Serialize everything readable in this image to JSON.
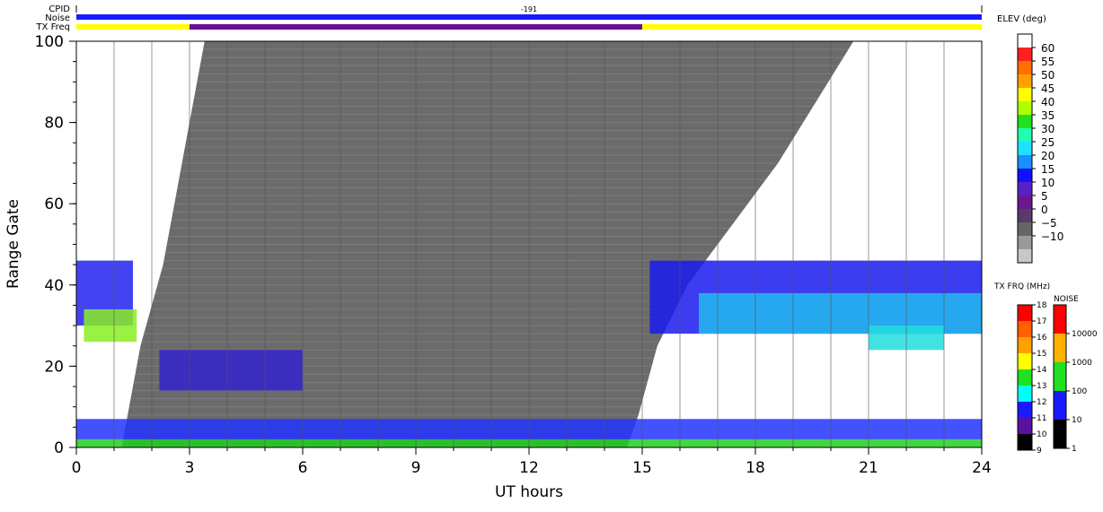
{
  "header": {
    "cpid_label": "CPID",
    "noise_label": "Noise",
    "txfreq_label": "TX Freq",
    "cpid_value": "-191"
  },
  "colors": {
    "ground_scatter": "#6b6b6b",
    "noise_band": "#1a1aff",
    "txfreq_low": "#ffff00",
    "txfreq_high": "#6a0f8e"
  },
  "chart_data": {
    "type": "heatmap",
    "xlabel": "UT hours",
    "ylabel": "Range Gate",
    "xlim": [
      0,
      24
    ],
    "ylim": [
      0,
      100
    ],
    "xticks": [
      0,
      3,
      6,
      9,
      12,
      15,
      18,
      21,
      24
    ],
    "yticks": [
      0,
      20,
      40,
      60,
      80,
      100
    ],
    "vertical_grid_hours": [
      1,
      2,
      3,
      4,
      5,
      6,
      7,
      8,
      9,
      10,
      11,
      12,
      13,
      14,
      15,
      16,
      17,
      18,
      19,
      20,
      21,
      22,
      23
    ],
    "txfreq_segments": [
      {
        "start": 0,
        "end": 3,
        "color": "#ffff00"
      },
      {
        "start": 3,
        "end": 15,
        "color": "#6a0f8e"
      },
      {
        "start": 15,
        "end": 24,
        "color": "#ffff00"
      }
    ],
    "ground_region_edge": [
      [
        1.2,
        0
      ],
      [
        1.3,
        5
      ],
      [
        1.5,
        15
      ],
      [
        1.7,
        25
      ],
      [
        2.0,
        35
      ],
      [
        2.3,
        45
      ],
      [
        2.6,
        60
      ],
      [
        2.9,
        75
      ],
      [
        3.2,
        90
      ],
      [
        3.4,
        100
      ]
    ],
    "ground_region_right_edge": [
      [
        14.6,
        0
      ],
      [
        14.9,
        8
      ],
      [
        15.4,
        25
      ],
      [
        16.2,
        40
      ],
      [
        17.4,
        55
      ],
      [
        18.6,
        70
      ],
      [
        19.6,
        85
      ],
      [
        20.6,
        100
      ]
    ],
    "echo_regions": [
      {
        "x0": 0,
        "x1": 1.5,
        "y0": 30,
        "y1": 46,
        "color": "#2222ee"
      },
      {
        "x0": 0.2,
        "x1": 1.6,
        "y0": 26,
        "y1": 34,
        "color": "#88ee22"
      },
      {
        "x0": 2.2,
        "x1": 6.0,
        "y0": 14,
        "y1": 24,
        "color": "#3322cc"
      },
      {
        "x0": 15.2,
        "x1": 24,
        "y0": 28,
        "y1": 46,
        "color": "#1a1aee"
      },
      {
        "x0": 16.5,
        "x1": 24,
        "y0": 28,
        "y1": 38,
        "color": "#22bbee"
      },
      {
        "x0": 21,
        "x1": 23,
        "y0": 24,
        "y1": 30,
        "color": "#22dddd"
      },
      {
        "x0": 0,
        "x1": 24,
        "y0": 0,
        "y1": 2,
        "color": "#22cc22"
      },
      {
        "x0": 0,
        "x1": 24,
        "y0": 2,
        "y1": 7,
        "color": "#2233ff"
      }
    ],
    "elev_legend": {
      "title": "ELEV (deg)",
      "ticks": [
        "60",
        "55",
        "50",
        "45",
        "40",
        "35",
        "30",
        "25",
        "20",
        "15",
        "10",
        "5",
        "0",
        "−5",
        "−10"
      ],
      "colors": [
        "#ffffff",
        "#ff2020",
        "#ff7000",
        "#ffa000",
        "#ffff00",
        "#b0ff00",
        "#20e020",
        "#20ffb0",
        "#20e0ff",
        "#1a90ff",
        "#1010ff",
        "#5a20c8",
        "#6a1890",
        "#5a3a6a",
        "#666666",
        "#999999",
        "#c8c8c8"
      ]
    },
    "txfrq_legend": {
      "title": "TX FRQ (MHz)",
      "ticks": [
        "18",
        "17",
        "16",
        "15",
        "14",
        "13",
        "12",
        "11",
        "10",
        "9"
      ],
      "colors": [
        "#ff0000",
        "#ff6000",
        "#ffa000",
        "#ffff00",
        "#20e020",
        "#00ffff",
        "#1a1aff",
        "#5a10a0",
        "#000000"
      ]
    },
    "noise_legend": {
      "title": "NOISE",
      "ticks": [
        "10000",
        "1000",
        "100",
        "10",
        "1"
      ],
      "colors": [
        "#ff0000",
        "#ffb000",
        "#20e020",
        "#1a1aff",
        "#000000"
      ]
    }
  }
}
